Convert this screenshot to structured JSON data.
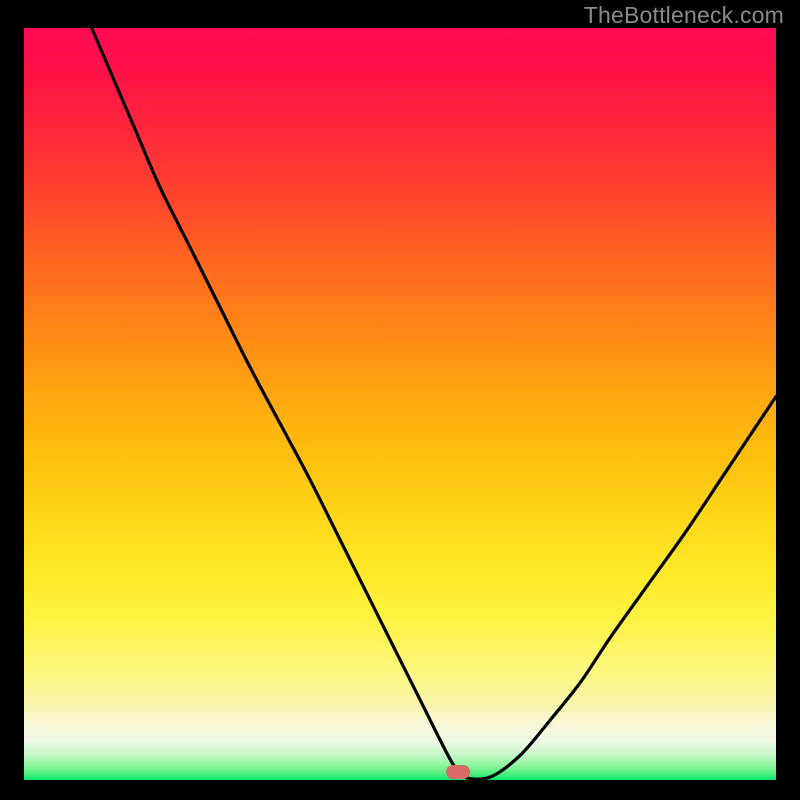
{
  "watermark": "TheBottleneck.com",
  "chart_data": {
    "type": "line",
    "title": "",
    "xlabel": "",
    "ylabel": "",
    "xlim": [
      0,
      100
    ],
    "ylim": [
      0,
      100
    ],
    "grid": false,
    "legend": false,
    "series": [
      {
        "name": "bottleneck-curve",
        "x": [
          9,
          12,
          15,
          18,
          22,
          26,
          30,
          34,
          38,
          42,
          45,
          48,
          51,
          53.5,
          55.5,
          57,
          58.5,
          62,
          66,
          70,
          74,
          78,
          83,
          88,
          93,
          98,
          100
        ],
        "y": [
          100,
          93,
          86,
          79,
          71,
          63,
          55,
          47.5,
          40,
          32,
          26,
          20,
          14,
          9,
          5,
          2.2,
          0.4,
          0.4,
          3.3,
          8,
          13,
          19,
          26,
          33,
          40.5,
          48,
          51
        ]
      }
    ],
    "marker": {
      "x": 57.7,
      "y": 1.1,
      "color": "#d96a69"
    },
    "background_gradient": {
      "top": "#ff0b52",
      "mid": "#ffcc14",
      "bottom": "#00ea71"
    }
  }
}
